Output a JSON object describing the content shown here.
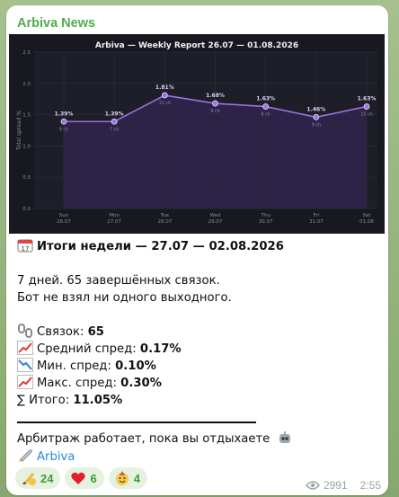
{
  "channel": {
    "name": "Arbiva News"
  },
  "chart_data": {
    "type": "area",
    "title": "Arbiva — Weekly Report  26.07 — 01.08.2026",
    "ylabel": "Total spread %",
    "xlabel": "",
    "ylim": [
      0,
      2.5
    ],
    "yticks": [
      "0.0",
      "0.5",
      "1.0",
      "1.5",
      "2.0",
      "2.5"
    ],
    "grid": true,
    "categories": [
      "Sun",
      "Mon",
      "Tue",
      "Wed",
      "Thu",
      "Fri",
      "Sat"
    ],
    "dates": [
      "26.07",
      "27.07",
      "28.07",
      "29.07",
      "30.07",
      "31.07",
      "01.08"
    ],
    "values": [
      1.39,
      1.39,
      1.81,
      1.68,
      1.63,
      1.46,
      1.63
    ],
    "value_labels": [
      "1.39%",
      "1.39%",
      "1.81%",
      "1.68%",
      "1.63%",
      "1.46%",
      "1.63%"
    ],
    "counts": [
      "9 ch",
      "7 ch",
      "11 ch",
      "9 ch",
      "8 ch",
      "9 ch",
      "10 ch"
    ],
    "line_color": "#9b73e0",
    "fill_color": "#2e2448",
    "background": "#171820"
  },
  "report": {
    "header": "Итоги недели — 27.07 — 02.08.2026",
    "line1": "7 дней. 65 завершённых связок.",
    "line2": "Бот не взял ни одного выходного.",
    "pairs_label": "Связок: ",
    "pairs_value": "65",
    "avg_label": "Средний спред: ",
    "avg_value": "0.17%",
    "min_label": "Мин. спред: ",
    "min_value": "0.10%",
    "max_label": "Макс. спред: ",
    "max_value": "0.30%",
    "total_label": "∑ Итого: ",
    "total_value": "11.05%"
  },
  "footer": {
    "tagline": "Арбитраж работает, пока вы отдыхаете",
    "link_text": "Arbiva"
  },
  "reactions": [
    {
      "icon": "writing-hand-icon",
      "count": "24"
    },
    {
      "icon": "red-heart-icon",
      "count": "6"
    },
    {
      "icon": "party-face-icon",
      "count": "4"
    }
  ],
  "meta": {
    "views": "2991",
    "time": "2:55"
  }
}
